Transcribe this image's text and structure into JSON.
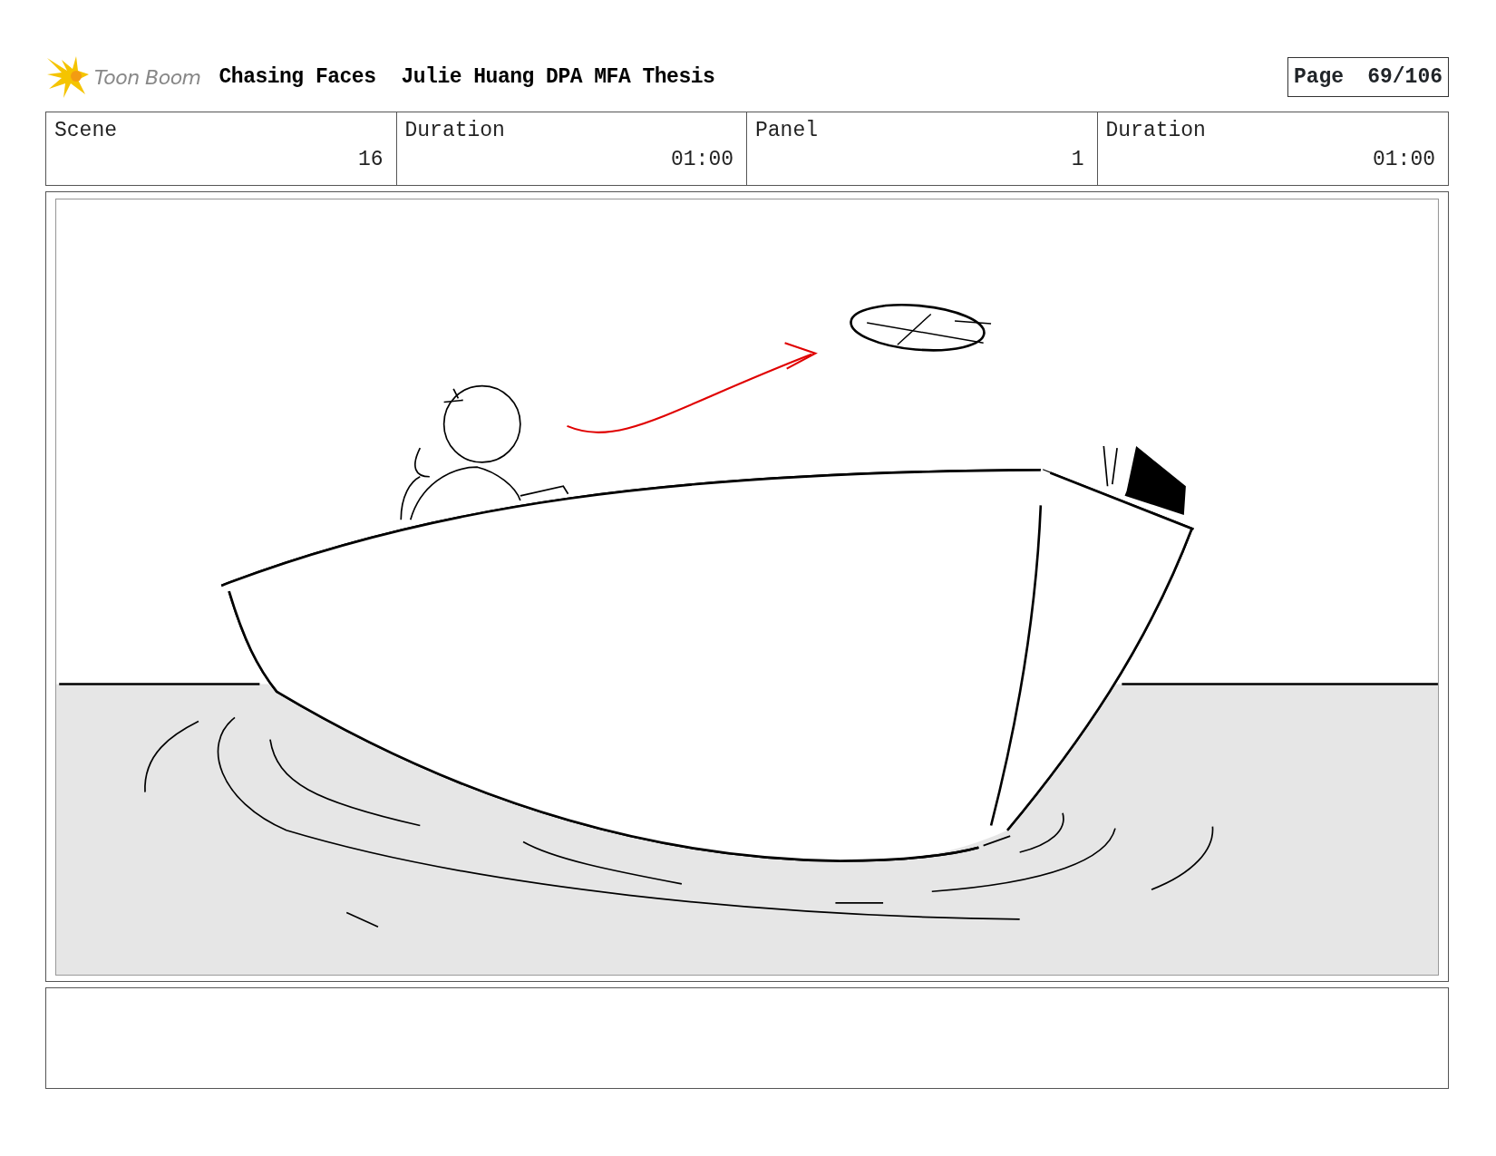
{
  "header": {
    "logo_text": "Toon Boom",
    "title": "Chasing Faces",
    "subtitle": "Julie Huang DPA MFA Thesis",
    "page_label": "Page",
    "page": "69/106"
  },
  "fields": [
    {
      "label": "Scene",
      "value": "16"
    },
    {
      "label": "Duration",
      "value": "01:00"
    },
    {
      "label": "Panel",
      "value": "1"
    },
    {
      "label": "Duration",
      "value": "01:00"
    }
  ]
}
